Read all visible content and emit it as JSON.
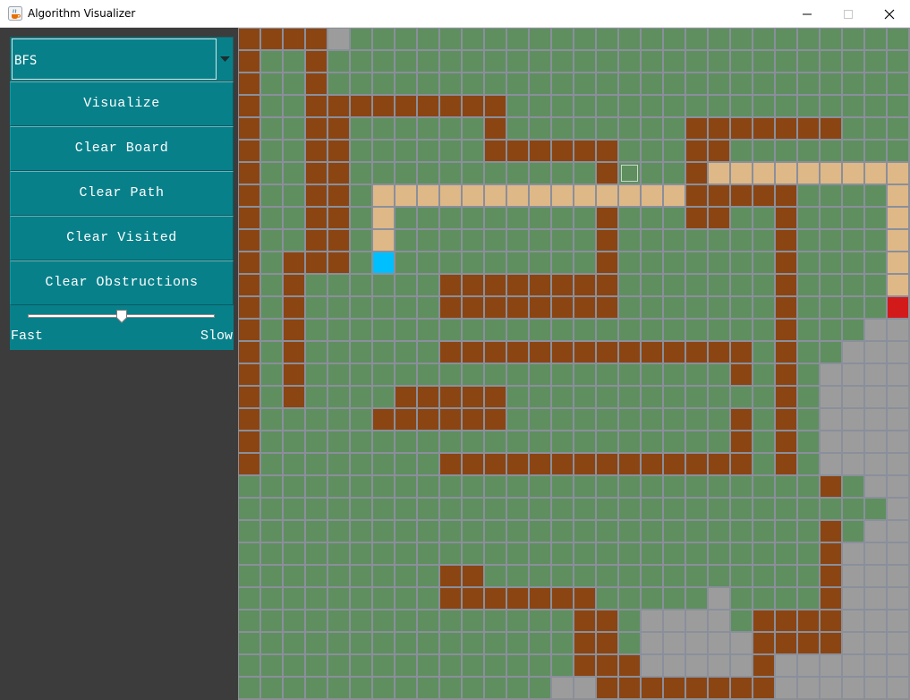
{
  "window": {
    "title": "Algorithm Visualizer",
    "icon": "java-cup-icon"
  },
  "sidebar": {
    "algorithm_select": {
      "value": "BFS"
    },
    "buttons": {
      "visualize": "Visualize",
      "clear_board": "Clear Board",
      "clear_path": "Clear Path",
      "clear_visited": "Clear Visited",
      "clear_obstructions": "Clear Obstructions"
    },
    "speed_slider": {
      "value": 0.5,
      "min_label": "Fast",
      "max_label": "Slow"
    }
  },
  "grid": {
    "rows": 30,
    "cols": 30,
    "legend": {
      "0": "empty",
      "1": "wall",
      "2": "visited",
      "3": "path",
      "4": "start",
      "5": "end",
      "6": "selected"
    },
    "colors": {
      "empty": "#5f8f5f",
      "wall": "#8b4513",
      "visited": "#9c9c9c",
      "path": "#deb887",
      "start": "#00bfff",
      "end": "#d21a1a",
      "cell_border": "#8a8f9b",
      "sidebar_panel": "#08808a",
      "sidebar_bg": "#3c3c3c"
    },
    "cells": [
      "111120000000000000000000000000",
      "100100000000000000000000000000",
      "100100000000000000000000000000",
      "100111111111000000000000000000",
      "100110000001000000001111111000",
      "100110000001111110001100000000",
      "100110000000000016001333333333",
      "100110333333333333331111100003",
      "100110300000000010001100100003",
      "100110300000000010000000100003",
      "101110400000000010000000100003",
      "101000000111111110000000100003",
      "101000000111111110000000100005",
      "101000000000000000000000100022",
      "101000000111111111111110100222",
      "101000000000000000000010102222",
      "101000011111000000000000102222",
      "100000111111000000000010102222",
      "100000000000000000000010102222",
      "100000000111111111111110102222",
      "000000000000000000000000001022",
      "000000000000000000000000000002",
      "000000000000000000000000001022",
      "000000000000000000000000001222",
      "000000000110000000000000001222",
      "000000000111111100000200001222",
      "000000000000000110222201111222",
      "000000000000000110222221111222",
      "000000000000000111222221222222",
      "000000000000002211111111222222"
    ]
  }
}
